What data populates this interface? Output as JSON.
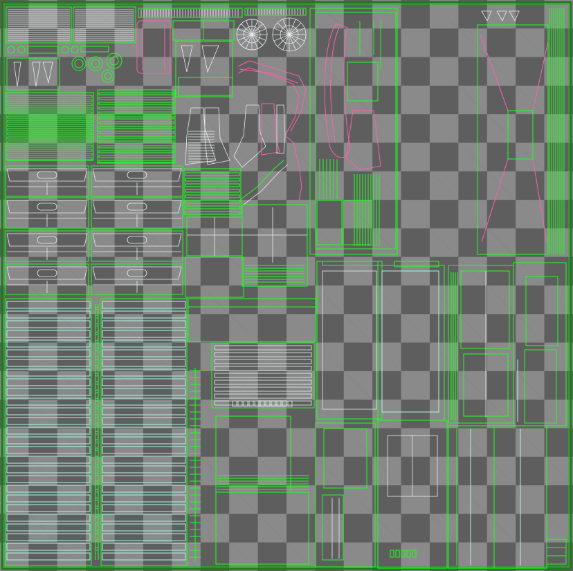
{
  "viewer": {
    "kind": "UV layout texture editor",
    "background": "checker",
    "checker_colors": [
      "#5e5e5e",
      "#8a8a8a"
    ],
    "wire_colors": {
      "uv_green": "#22ff22",
      "uv_cyan": "#aef5e6",
      "uv_pink": "#ff5fb0",
      "uv_white": "#e8f0f0"
    }
  }
}
